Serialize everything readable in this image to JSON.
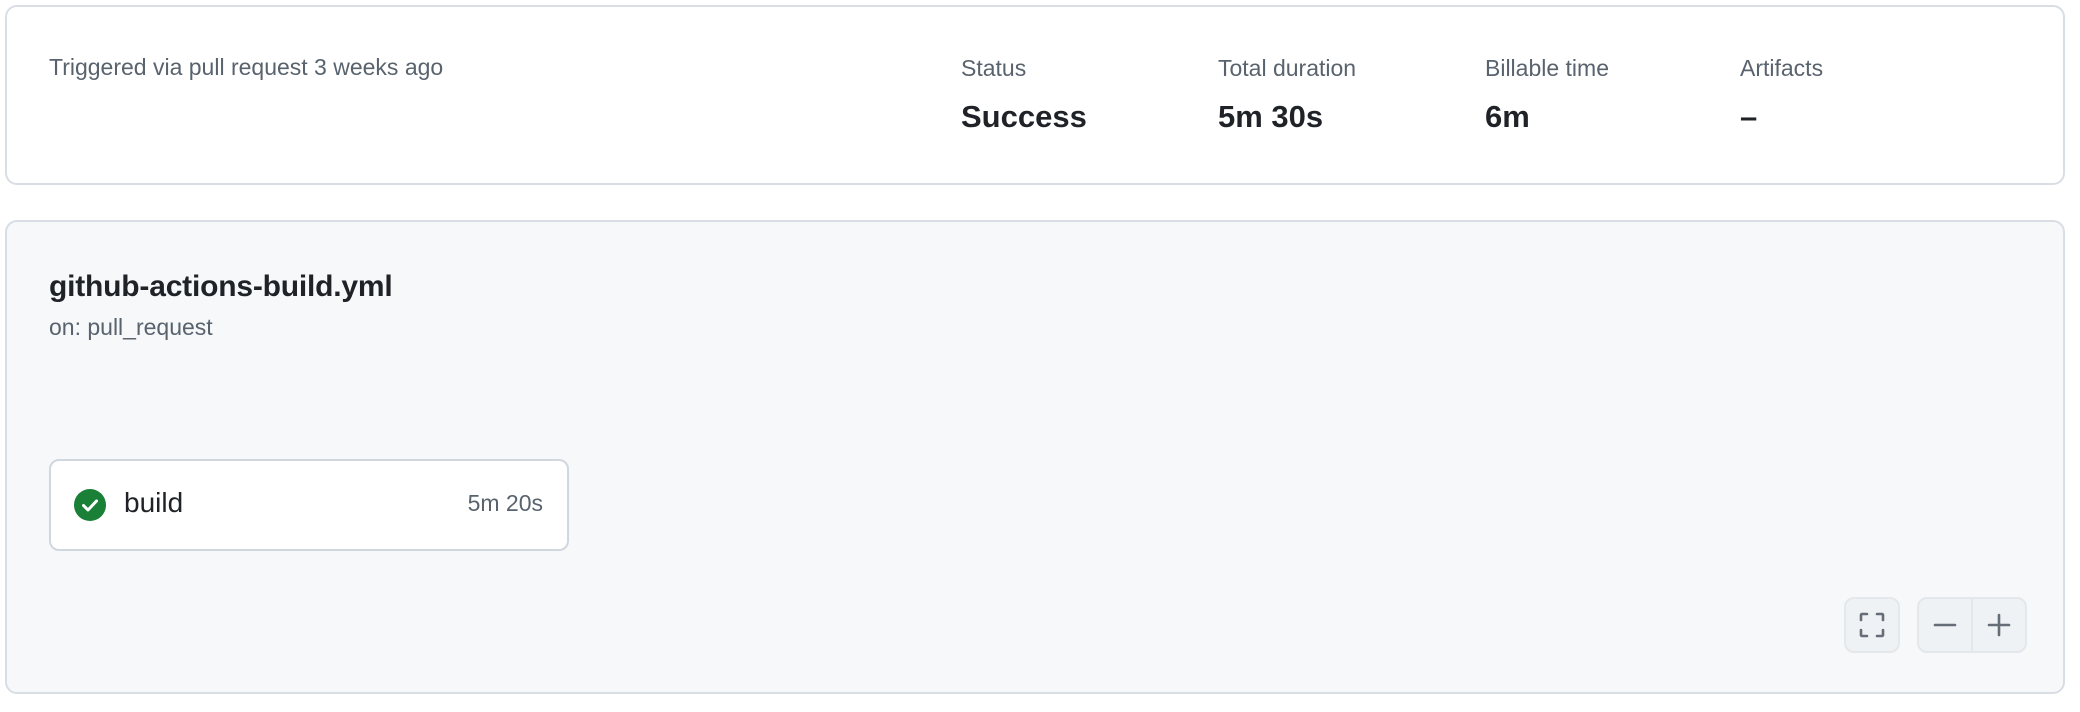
{
  "summary": {
    "trigger_text": "Triggered via pull request 3 weeks ago",
    "stats": {
      "status": {
        "label": "Status",
        "value": "Success"
      },
      "total_duration": {
        "label": "Total duration",
        "value": "5m 30s"
      },
      "billable_time": {
        "label": "Billable time",
        "value": "6m"
      },
      "artifacts": {
        "label": "Artifacts",
        "value": "–"
      }
    }
  },
  "workflow": {
    "title": "github-actions-build.yml",
    "trigger": "on: pull_request",
    "jobs": [
      {
        "name": "build",
        "duration": "5m 20s",
        "status": "success",
        "status_icon": "check-circle-fill-icon"
      }
    ]
  },
  "graph_controls": {
    "fullscreen_icon": "screen-full-icon",
    "zoom_out_icon": "minus-icon",
    "zoom_in_icon": "plus-icon"
  },
  "colors": {
    "success": "#1a7f37",
    "muted_text": "#59636e",
    "primary_text": "#1f2328",
    "border": "#d0d7de",
    "canvas_subtle": "#f6f8fa"
  }
}
